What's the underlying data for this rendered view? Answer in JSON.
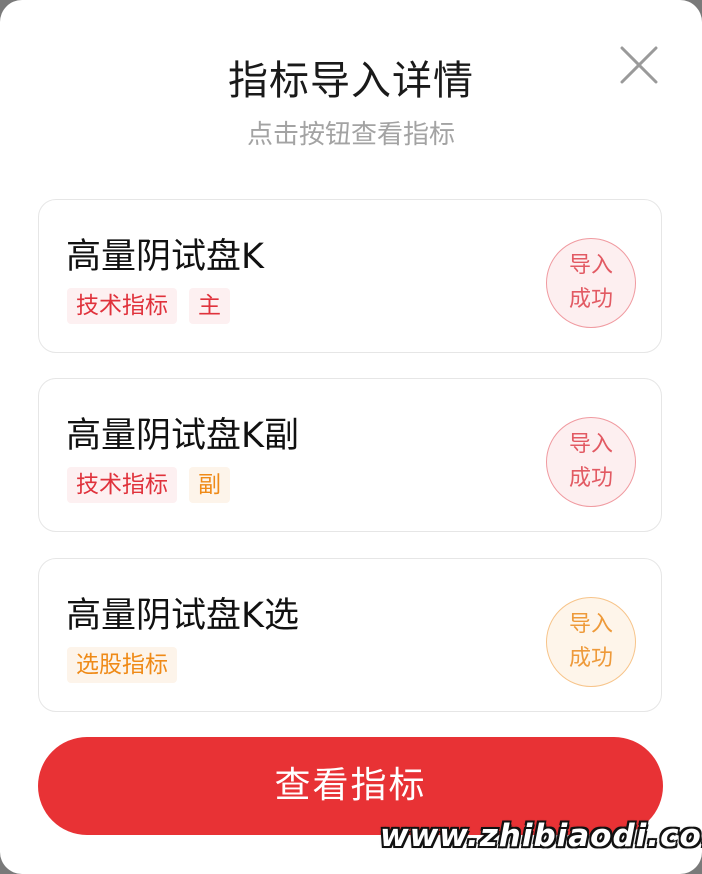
{
  "modal": {
    "title": "指标导入详情",
    "subtitle": "点击按钮查看指标"
  },
  "icons": {
    "close": "close-icon"
  },
  "cards": [
    {
      "name": "高量阴试盘K",
      "tags": [
        {
          "label": "技术指标",
          "color": "#e0323c"
        },
        {
          "label": "主",
          "color": "#e0323c"
        }
      ],
      "status": {
        "line1": "导入",
        "line2": "成功",
        "color": "#e25a63"
      }
    },
    {
      "name": "高量阴试盘K副",
      "tags": [
        {
          "label": "技术指标",
          "color": "#e0323c"
        },
        {
          "label": "副",
          "color": "#ef8a17"
        }
      ],
      "status": {
        "line1": "导入",
        "line2": "成功",
        "color": "#e25a63"
      }
    },
    {
      "name": "高量阴试盘K选",
      "tags": [
        {
          "label": "选股指标",
          "color": "#ef8a17"
        }
      ],
      "status": {
        "line1": "导入",
        "line2": "成功",
        "color": "#ee9a3a"
      }
    }
  ],
  "actions": {
    "view_label": "查看指标",
    "view_color": "#e83235"
  },
  "watermark": "www.zhibiaodi.com"
}
